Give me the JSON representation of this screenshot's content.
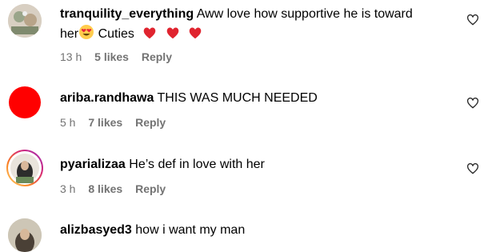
{
  "comments": [
    {
      "username": "tranquility_everything",
      "text_line1": "Aww love how supportive he is toward",
      "text_line2_a": "her",
      "text_line2_b": "Cuties",
      "time": "13 h",
      "likes": "5 likes",
      "reply": "Reply",
      "emojis": [
        "heart-eyes-emoji",
        "red-heart-emoji",
        "red-heart-emoji",
        "red-heart-emoji"
      ]
    },
    {
      "username": "ariba.randhawa",
      "text": "THIS WAS MUCH NEEDED",
      "time": "5 h",
      "likes": "7 likes",
      "reply": "Reply",
      "avatar_color": "#ff0000"
    },
    {
      "username": "pyarializaa",
      "text": "He’s def in love with her",
      "time": "3 h",
      "likes": "8 likes",
      "reply": "Reply"
    },
    {
      "username": "alizbasyed3",
      "text": "how i want my man"
    }
  ],
  "colors": {
    "meta_text": "#737373",
    "story_ring_start": "#feda75",
    "story_ring_end": "#d62976"
  }
}
